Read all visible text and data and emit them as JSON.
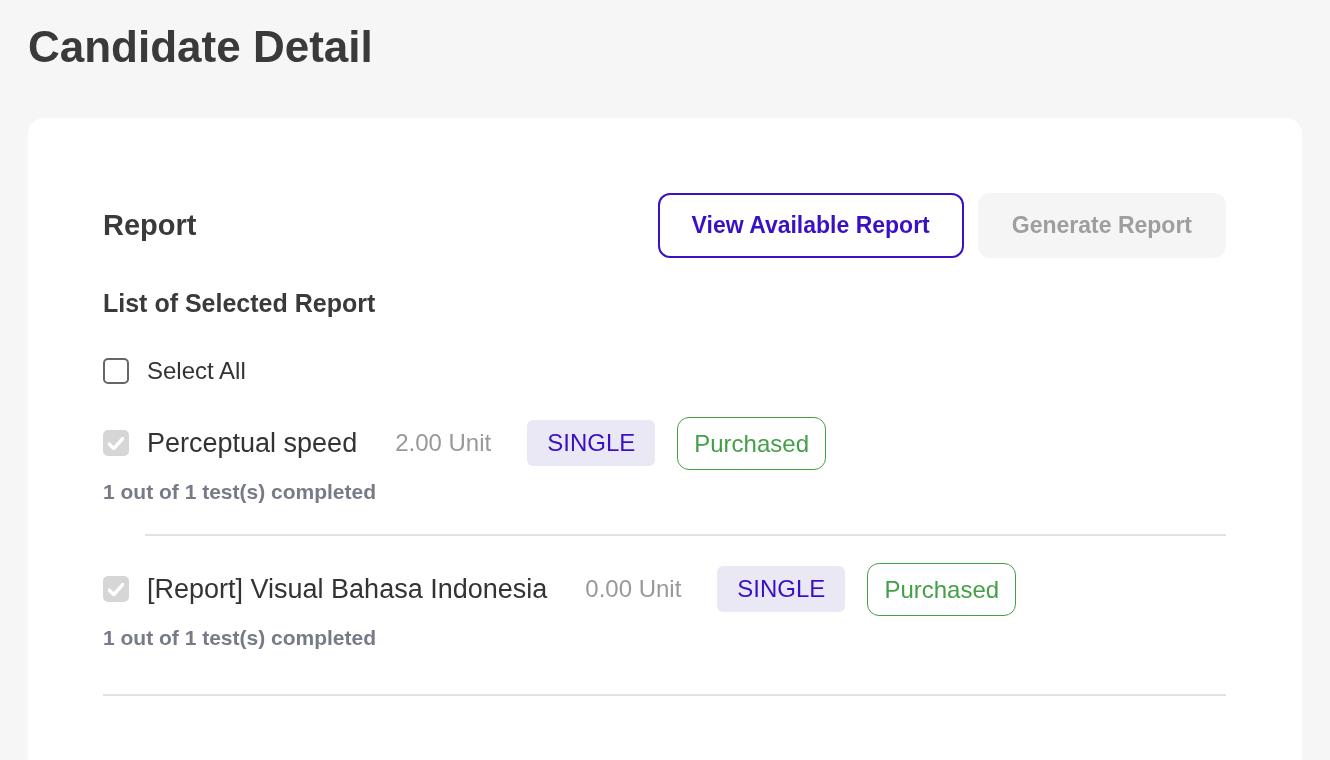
{
  "page": {
    "title": "Candidate Detail"
  },
  "report": {
    "heading": "Report",
    "buttons": [
      {
        "label": "View Available Report",
        "kind": "outline",
        "disabled": false
      },
      {
        "label": "Generate Report",
        "kind": "filled",
        "disabled": true
      }
    ],
    "list_heading": "List of Selected Report",
    "select_all": {
      "label": "Select All",
      "checked": false,
      "disabled": false
    },
    "items": [
      {
        "name": "Perceptual speed",
        "units": "2.00 Unit",
        "type": "SINGLE",
        "status": "Purchased",
        "progress": "1 out of 1 test(s) completed",
        "checked": true,
        "disabled": true
      },
      {
        "name": "[Report] Visual Bahasa Indonesia",
        "units": "0.00 Unit",
        "type": "SINGLE",
        "status": "Purchased",
        "progress": "1 out of 1 test(s) completed",
        "checked": true,
        "disabled": true
      }
    ]
  }
}
